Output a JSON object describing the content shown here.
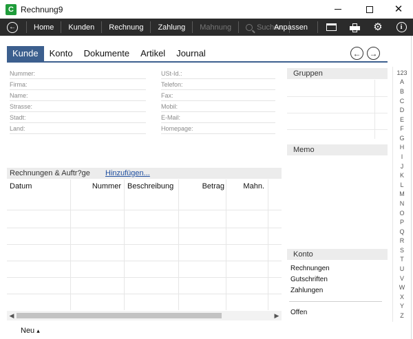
{
  "window": {
    "logo_letter": "C",
    "title": "Rechnung9",
    "minimize_glyph": "—",
    "maximize_glyph": "□",
    "close_glyph": "✕"
  },
  "toolbar": {
    "back_icon": "back-arrow-icon",
    "items": [
      "Home",
      "Kunden",
      "Rechnung",
      "Zahlung",
      "Mahnung"
    ],
    "search_label": "Suchen",
    "customize_label": "Anpassen",
    "right_icons": [
      "card-icon",
      "printer-icon",
      "gear-icon",
      "info-icon"
    ]
  },
  "tabs": [
    "Kunde",
    "Konto",
    "Dokumente",
    "Artikel",
    "Journal"
  ],
  "nav": {
    "prev_glyph": "←",
    "next_glyph": "→"
  },
  "customer_fields_left": [
    "Nummer:",
    "Firma:",
    "Name:",
    "Strasse:",
    "Stadt:",
    "Land:"
  ],
  "customer_fields_right": [
    "USt-Id.:",
    "Telefon:",
    "Fax:",
    "Mobil:",
    "E-Mail:",
    "Homepage:"
  ],
  "invoices": {
    "title": "Rechnungen & Auftr?ge",
    "add_link": "Hinzufügen...",
    "columns": [
      "Datum",
      "Nummer",
      "Beschreibung",
      "Betrag",
      "Mahn."
    ]
  },
  "groups_title": "Gruppen",
  "memo_title": "Memo",
  "konto": {
    "title": "Konto",
    "items": [
      "Rechnungen",
      "Gutschriften",
      "Zahlungen"
    ],
    "balance_label": "Offen"
  },
  "footer": {
    "new_label": "Neu",
    "new_caret": "▴"
  },
  "alphabet": [
    "123",
    "A",
    "B",
    "C",
    "D",
    "E",
    "F",
    "G",
    "H",
    "I",
    "J",
    "K",
    "L",
    "M",
    "N",
    "O",
    "P",
    "Q",
    "R",
    "S",
    "T",
    "U",
    "V",
    "W",
    "X",
    "Y",
    "Z"
  ],
  "scrollbar": {
    "left_glyph": "◀",
    "right_glyph": "▶"
  },
  "colors": {
    "accent": "#3c5f8e",
    "toolbar_bg": "#2b2b2b",
    "logo": "#1f9c3a",
    "link": "#1f4fa0"
  }
}
